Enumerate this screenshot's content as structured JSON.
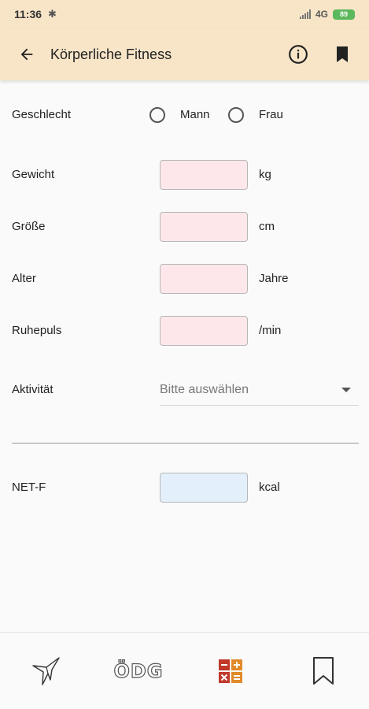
{
  "status": {
    "time": "11:36",
    "bluetooth_icon": "bluetooth-icon",
    "network": "4G",
    "battery": "89"
  },
  "appbar": {
    "title": "Körperliche Fitness",
    "back_icon": "arrow-left-icon",
    "info_icon": "info-icon",
    "bookmark_icon": "bookmark-filled-icon"
  },
  "form": {
    "gender": {
      "label": "Geschlecht",
      "options": [
        "Mann",
        "Frau"
      ]
    },
    "weight": {
      "label": "Gewicht",
      "unit": "kg",
      "value": ""
    },
    "height": {
      "label": "Größe",
      "unit": "cm",
      "value": ""
    },
    "age": {
      "label": "Alter",
      "unit": "Jahre",
      "value": ""
    },
    "pulse": {
      "label": "Ruhepuls",
      "unit": "/min",
      "value": ""
    },
    "activity": {
      "label": "Aktivität",
      "placeholder": "Bitte auswählen"
    }
  },
  "result": {
    "label": "NET-F",
    "unit": "kcal",
    "value": ""
  },
  "bottom_nav": {
    "items": [
      "bird-icon",
      "ÖDG",
      "calculator-icon",
      "bookmark-outline-icon"
    ],
    "odg_label": "ÖDG",
    "calculator_colors": [
      "#c0392b",
      "#e08a2a"
    ]
  },
  "colors": {
    "header_bg": "#f8e5c8",
    "input_bg": "#fde7ea",
    "result_bg": "#e3f0fc"
  }
}
